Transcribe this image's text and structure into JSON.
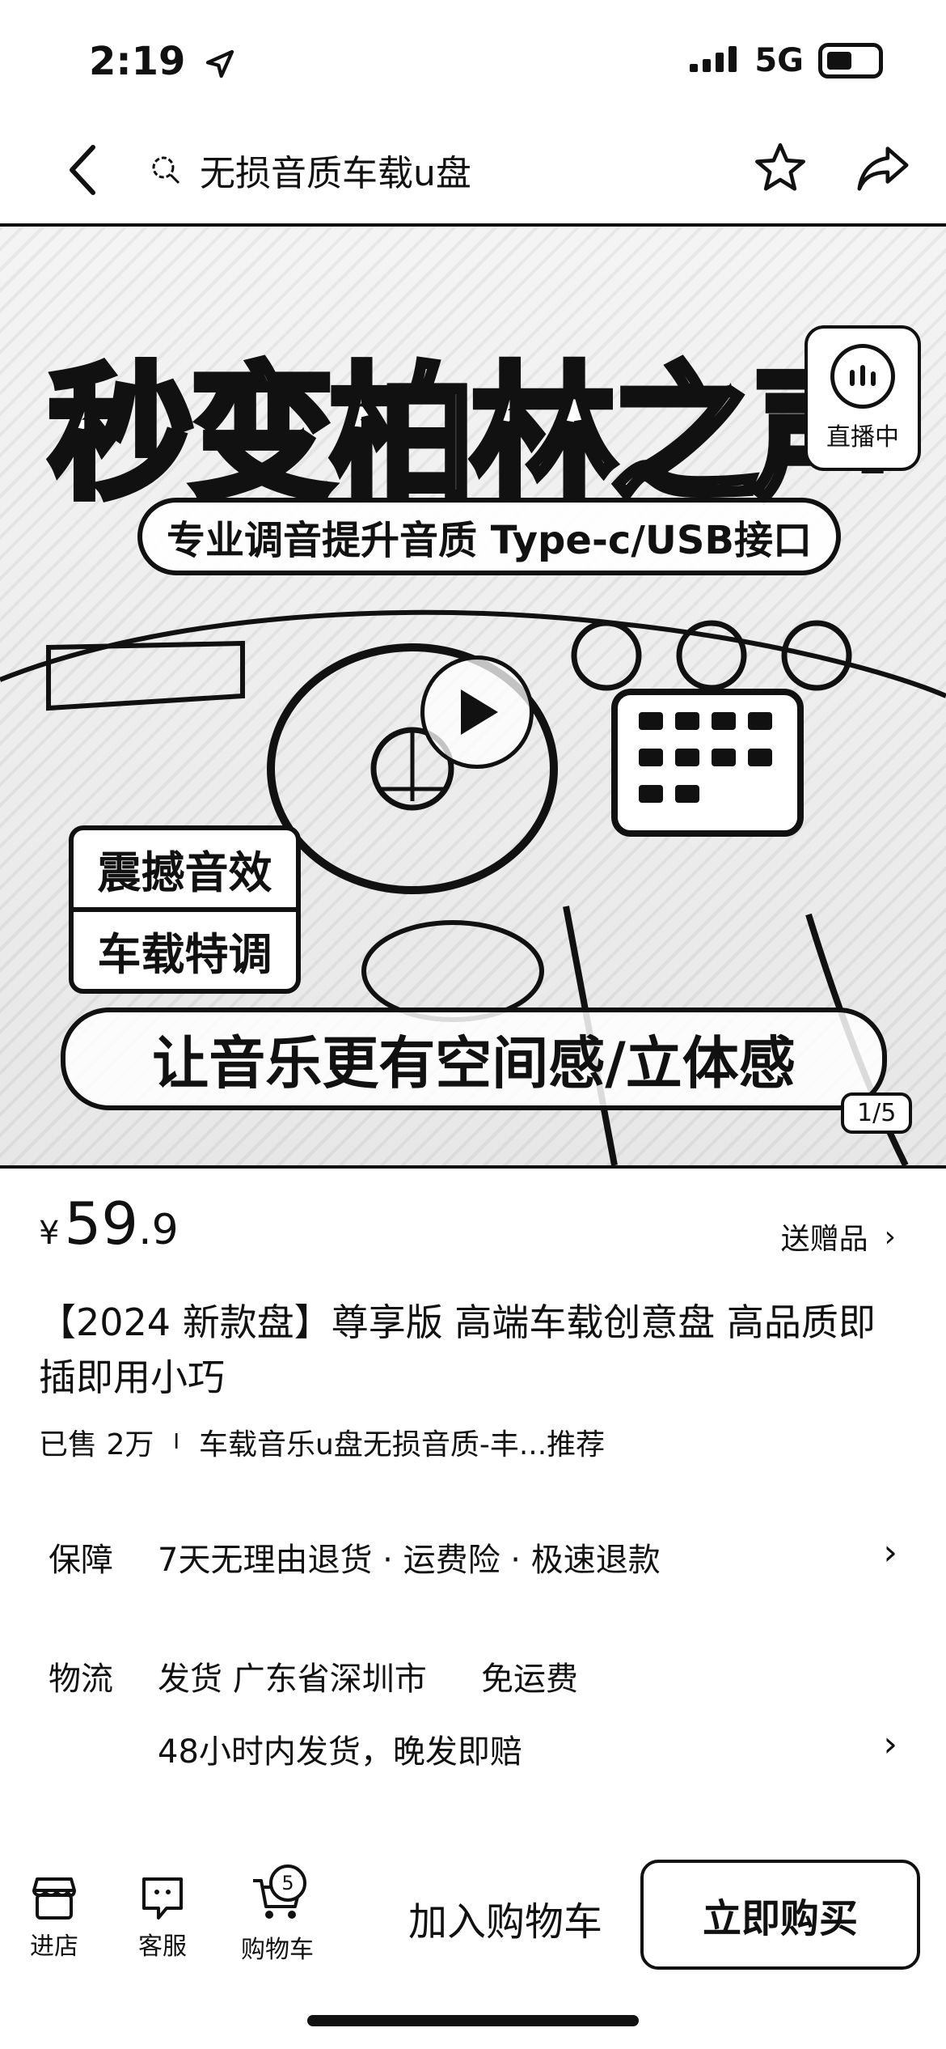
{
  "status_bar": {
    "time": "2:19",
    "network": "5G"
  },
  "nav": {
    "search_text": "无损音质车载u盘"
  },
  "hero": {
    "headline": "秒变柏林之声",
    "banner": "专业调音提升音质 Type-c/USB接口",
    "live_label": "直播中",
    "badge_top": "震撼音效",
    "badge_bottom": "车载特调",
    "bottom_slogan": "让音乐更有空间感/立体感",
    "counter": "1/5"
  },
  "price": {
    "currency": "¥",
    "integer": "59",
    "decimal": ".9",
    "gift_label": "送赠品"
  },
  "product": {
    "title": "【2024 新款盘】尊享版  高端车载创意盘  高品质即插即用小巧",
    "sold": "已售 2万",
    "separator": "I",
    "ranking": "车载音乐u盘无损音质-丰...推荐"
  },
  "guarantee": {
    "label": "保障",
    "text": "7天无理由退货 · 运费险 · 极速退款"
  },
  "logistics": {
    "label": "物流",
    "ship_from": "发货 广东省深圳市",
    "shipping_fee": "免运费",
    "promise": "48小时内发货，晚发即赔"
  },
  "bottom_bar": {
    "store": "进店",
    "service": "客服",
    "cart": "购物车",
    "cart_count": "5",
    "add_to_cart": "加入购物车",
    "buy_now": "立即购买"
  }
}
